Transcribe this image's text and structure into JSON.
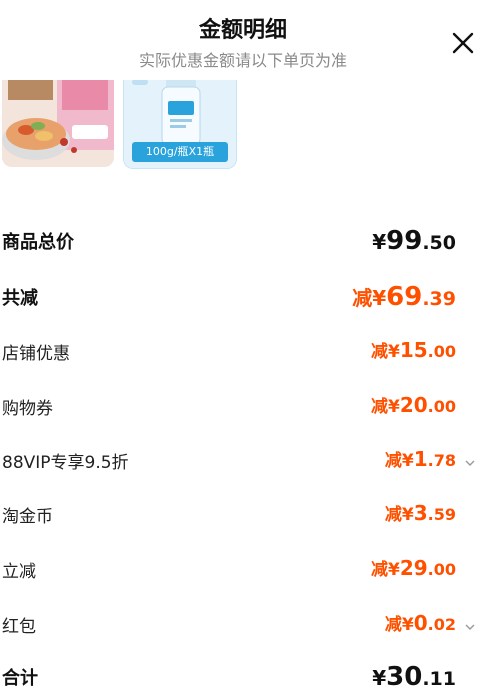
{
  "header": {
    "title": "金额明细",
    "subtitle": "实际优惠金额请以下单页为准",
    "close_icon": "close-icon"
  },
  "products": [
    {
      "name": "",
      "image_icon": "noodle-product-image"
    },
    {
      "name": "",
      "image_icon": "bottle-product-image",
      "qty_label": "100g/瓶X1瓶"
    }
  ],
  "summary": {
    "subtotal": {
      "label": "商品总价",
      "yen": "¥",
      "int": "99",
      "dec": ".50"
    },
    "total_discount": {
      "label": "共减",
      "prefix": "减",
      "yen": "¥",
      "int": "69",
      "dec": ".39"
    },
    "shop_discount": {
      "label": "店铺优惠",
      "prefix": "减",
      "yen": "¥",
      "int": "15",
      "dec": ".00"
    },
    "coupon": {
      "label": "购物券",
      "prefix": "减",
      "yen": "¥",
      "int": "20",
      "dec": ".00"
    },
    "vip": {
      "label": "88VIP专享9.5折",
      "prefix": "减",
      "yen": "¥",
      "int": "1",
      "dec": ".78"
    },
    "taojinbi": {
      "label": "淘金币",
      "prefix": "减",
      "yen": "¥",
      "int": "3",
      "dec": ".59"
    },
    "instant": {
      "label": "立减",
      "prefix": "减",
      "yen": "¥",
      "int": "29",
      "dec": ".00"
    },
    "red_packet": {
      "label": "红包",
      "prefix": "减",
      "yen": "¥",
      "int": "0",
      "dec": ".02"
    },
    "total": {
      "label": "合计",
      "yen": "¥",
      "int": "30",
      "dec": ".11"
    }
  },
  "colors": {
    "discount": "#ff5000",
    "text": "#111111",
    "subtle": "#8a8a8a",
    "chevron": "#999999"
  }
}
